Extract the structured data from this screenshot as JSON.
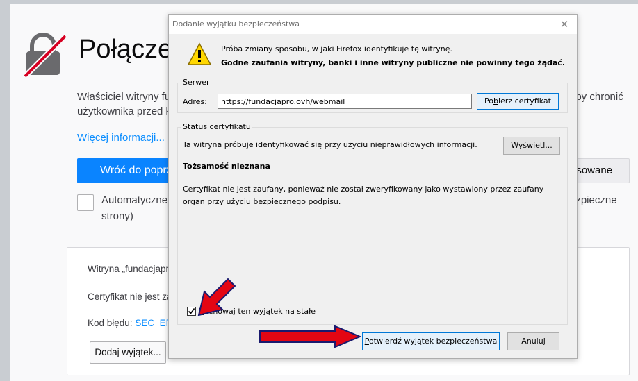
{
  "page": {
    "title": "Połączen",
    "paragraph_line1": "Właściciel witryny fun",
    "paragraph_line1_end": "aby chronić",
    "paragraph_line2": "użytkownika przed kra",
    "more_info": "Więcej informacji...",
    "back_button": "Wróć do poprze",
    "advanced_button": "nsowane",
    "auto_report_line1": "Automatyczne z",
    "auto_report_line1_end": "ezpieczne",
    "auto_report_line2": "strony)",
    "adv_line1": "Witryna „fundacjapro",
    "adv_line2": "Certyfikat nie jest zau",
    "error_label": "Kod błędu:",
    "error_code": "SEC_ERRO",
    "add_exception_button": "Dodaj wyjątek..."
  },
  "dialog": {
    "title": "Dodanie wyjątku bezpieczeństwa",
    "close_glyph": "✕",
    "warning_line1": "Próba zmiany sposobu, w jaki Firefox identyfikuje tę witrynę.",
    "warning_line2": "Godne zaufania witryny, banki i inne witryny publiczne nie powinny tego żądać.",
    "server_legend": "Serwer",
    "address_label": "Adres:",
    "address_value": "https://fundacjapro.ovh/webmail",
    "fetch_button": {
      "pre": "Po",
      "key": "b",
      "post": "ierz certyfikat"
    },
    "status_legend": "Status certyfikatu",
    "status_text": "Ta witryna próbuje identyfikować się przy użyciu nieprawidłowych informacji.",
    "view_button": {
      "key": "W",
      "post": "yświetl..."
    },
    "identity_heading": "Tożsamość nieznana",
    "cert_line1": "Certyfikat nie jest zaufany, ponieważ nie został zweryfikowany jako wystawiony przez zaufany",
    "cert_line2": "organ przy użyciu bezpiecznego podpisu.",
    "permanent_checkbox": {
      "key": "Z",
      "post": "achowaj ten wyjątek na stałe",
      "checked": true
    },
    "confirm_button": {
      "key": "P",
      "post": "otwierdź wyjątek bezpieczeństwa"
    },
    "cancel_button": "Anuluj"
  },
  "colors": {
    "accent_blue": "#0a84ff",
    "annotation_red": "#e30613",
    "warning_yellow": "#ffd700"
  }
}
